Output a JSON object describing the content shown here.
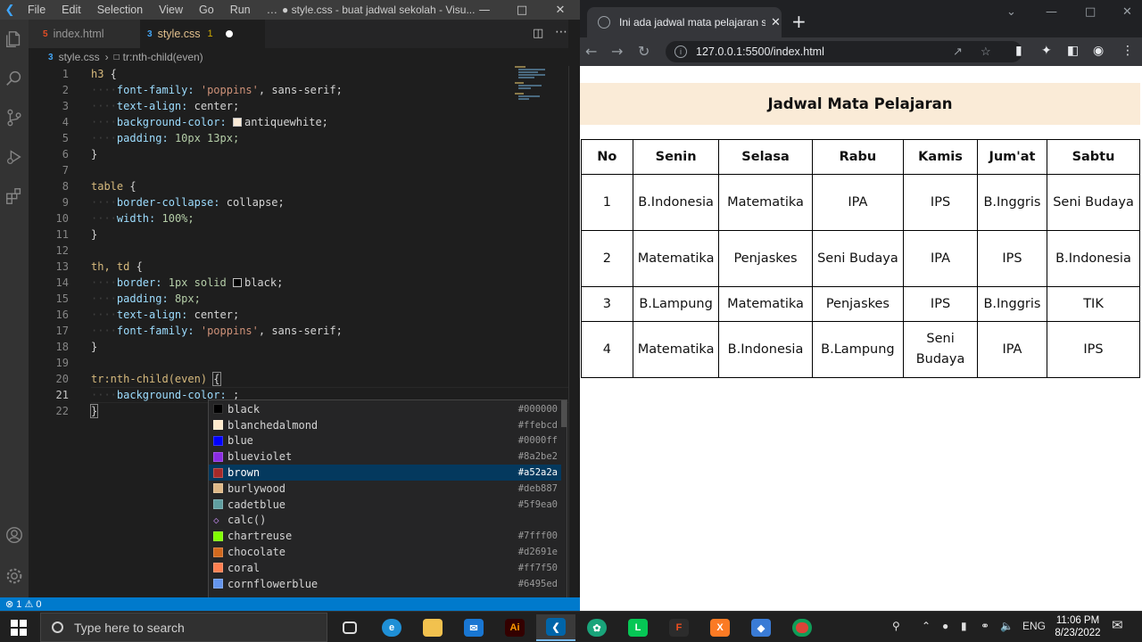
{
  "vscode": {
    "menu": [
      "File",
      "Edit",
      "Selection",
      "View",
      "Go",
      "Run",
      "…"
    ],
    "window_title": "● style.css - buat jadwal sekolah - Visu...",
    "tabs": [
      {
        "icon": "5",
        "label": "index.html"
      },
      {
        "icon": "3",
        "label": "style.css",
        "badge": "1"
      }
    ],
    "breadcrumb": {
      "file": "style.css",
      "symbol": "tr:nth-child(even)"
    },
    "line_numbers": [
      "1",
      "2",
      "3",
      "4",
      "5",
      "6",
      "7",
      "8",
      "9",
      "10",
      "11",
      "12",
      "13",
      "14",
      "15",
      "16",
      "17",
      "18",
      "19",
      "20",
      "21",
      "22"
    ],
    "code": {
      "l1_sel": "h3",
      "l2_prop": "font-family:",
      "l2_val": "'poppins'",
      "l2_rest": ", sans-serif;",
      "l3_prop": "text-align:",
      "l3_val": "center;",
      "l4_prop": "background-color:",
      "l4_val": "antiquewhite;",
      "l5_prop": "padding:",
      "l5_val": "10px 13px;",
      "l8_sel": "table",
      "l9_prop": "border-collapse:",
      "l9_val": "collapse;",
      "l10_prop": "width:",
      "l10_val": "100%;",
      "l13_sel": "th, td",
      "l14_prop": "border:",
      "l14_val1": "1px solid",
      "l14_val2": "black;",
      "l15_prop": "padding:",
      "l15_val": "8px;",
      "l16_prop": "text-align:",
      "l16_val": "center;",
      "l17_prop": "font-family:",
      "l17_val": "'poppins'",
      "l17_rest": ", sans-serif;",
      "l20_sel": "tr:nth-child(even)",
      "l21_prop": "background-color:",
      "l21_rest": ";"
    },
    "suggest": {
      "items": [
        {
          "label": "black",
          "hex": "#000000",
          "color": "#000000"
        },
        {
          "label": "blanchedalmond",
          "hex": "#ffebcd",
          "color": "#ffebcd"
        },
        {
          "label": "blue",
          "hex": "#0000ff",
          "color": "#0000ff"
        },
        {
          "label": "blueviolet",
          "hex": "#8a2be2",
          "color": "#8a2be2"
        },
        {
          "label": "brown",
          "hex": "#a52a2a",
          "color": "#a52a2a"
        },
        {
          "label": "burlywood",
          "hex": "#deb887",
          "color": "#deb887"
        },
        {
          "label": "cadetblue",
          "hex": "#5f9ea0",
          "color": "#5f9ea0"
        },
        {
          "label": "calc()",
          "hex": "",
          "color": ""
        },
        {
          "label": "chartreuse",
          "hex": "#7fff00",
          "color": "#7fff00"
        },
        {
          "label": "chocolate",
          "hex": "#d2691e",
          "color": "#d2691e"
        },
        {
          "label": "coral",
          "hex": "#ff7f50",
          "color": "#ff7f50"
        },
        {
          "label": "cornflowerblue",
          "hex": "#6495ed",
          "color": "#6495ed"
        }
      ],
      "selected_index": 4,
      "detail": "#a52a2a"
    },
    "status": {
      "errors": "⊗ 1 ⚠ 0"
    }
  },
  "chrome": {
    "tab_title": "Ini ada jadwal mata pelajaran saya",
    "url": "127.0.0.1:5500/index.html"
  },
  "page": {
    "heading": "Jadwal Mata Pelajaran",
    "headers": [
      "No",
      "Senin",
      "Selasa",
      "Rabu",
      "Kamis",
      "Jum'at",
      "Sabtu"
    ],
    "rows": [
      [
        "1",
        "B.Indonesia",
        "Matematika",
        "IPA",
        "IPS",
        "B.Inggris",
        "Seni Budaya"
      ],
      [
        "2",
        "Matematika",
        "Penjaskes",
        "Seni Budaya",
        "IPA",
        "IPS",
        "B.Indonesia"
      ],
      [
        "3",
        "B.Lampung",
        "Matematika",
        "Penjaskes",
        "IPS",
        "B.Inggris",
        "TIK"
      ],
      [
        "4",
        "Matematika",
        "B.Indonesia",
        "B.Lampung",
        "Seni Budaya",
        "IPA",
        "IPS"
      ]
    ]
  },
  "taskbar": {
    "search_placeholder": "Type here to search",
    "lang": "ENG",
    "time": "11:06 PM",
    "date": "8/23/2022"
  }
}
